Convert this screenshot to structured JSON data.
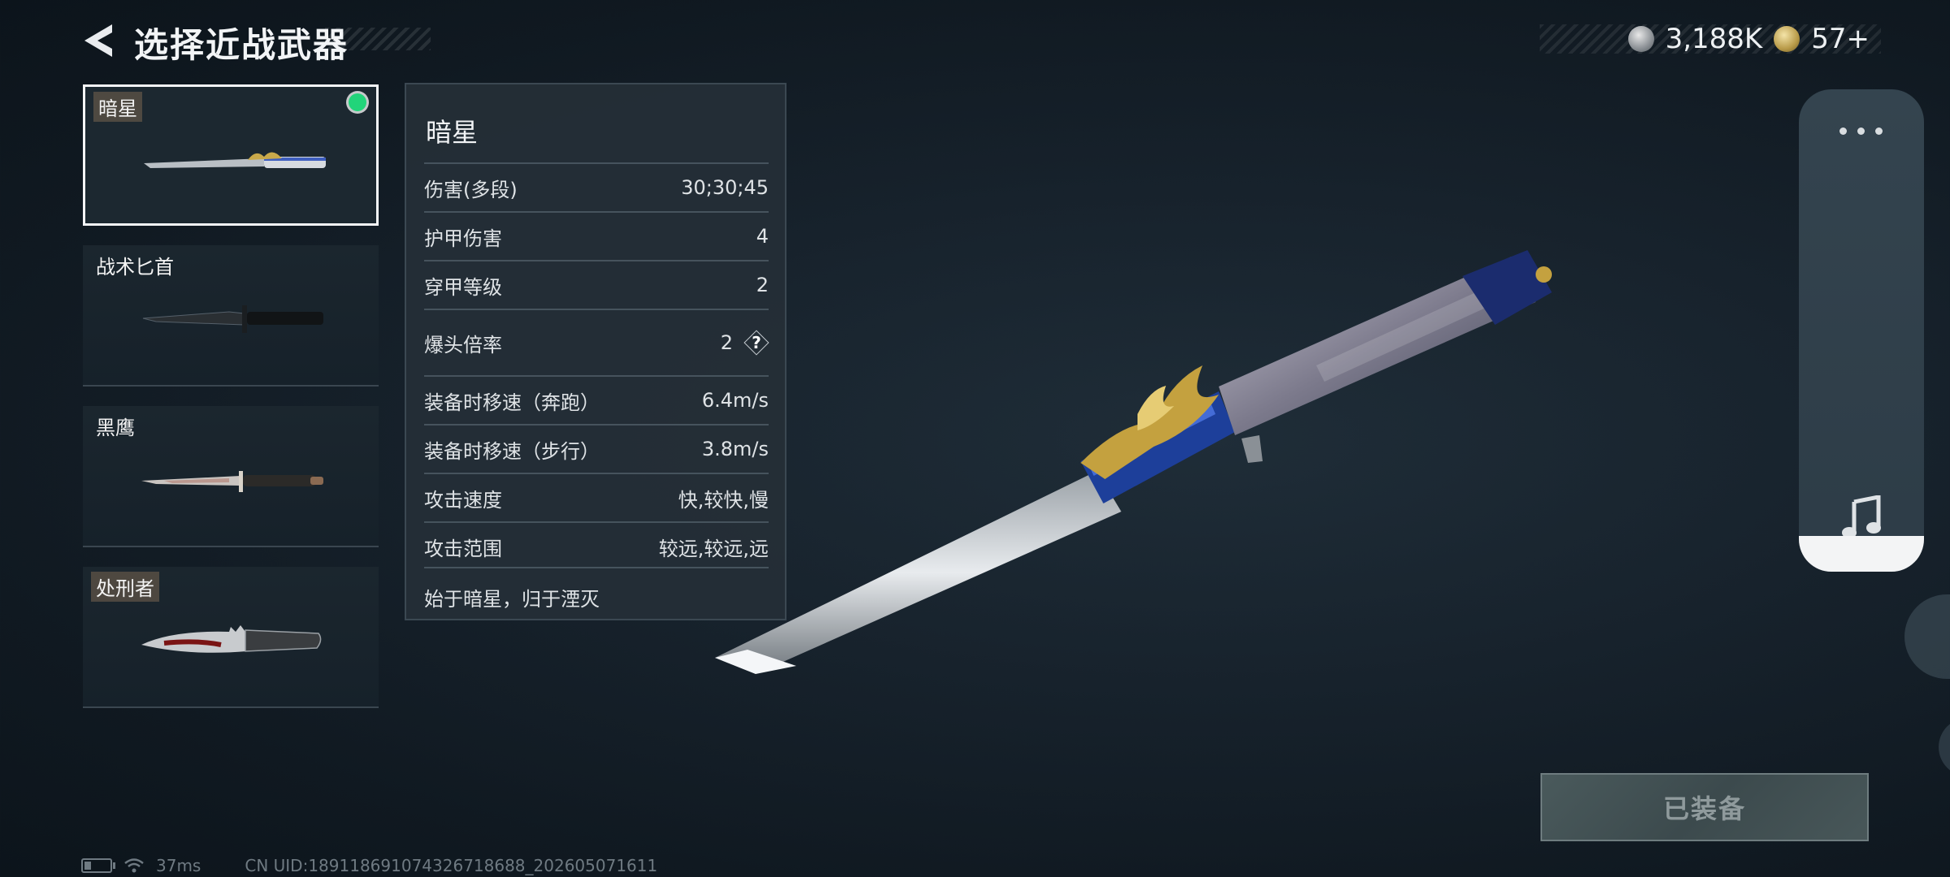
{
  "header": {
    "title": "选择近战武器",
    "currencies": [
      {
        "icon": "silver-coin-icon",
        "value": "3,188K"
      },
      {
        "icon": "gold-coin-icon",
        "value": "57+"
      }
    ]
  },
  "weapons": [
    {
      "name": "暗星",
      "selected": true,
      "equipped": true
    },
    {
      "name": "战术匕首",
      "selected": false,
      "equipped": false
    },
    {
      "name": "黑鹰",
      "selected": false,
      "equipped": false
    },
    {
      "name": "处刑者",
      "selected": false,
      "equipped": false
    }
  ],
  "stats_panel": {
    "weapon_name": "暗星",
    "rows": [
      {
        "label": "伤害(多段)",
        "value": "30;30;45"
      },
      {
        "label": "护甲伤害",
        "value": "4"
      },
      {
        "label": "穿甲等级",
        "value": "2"
      },
      {
        "label": "爆头倍率",
        "value": "2"
      },
      {
        "label": "装备时移速（奔跑）",
        "value": "6.4m/s"
      },
      {
        "label": "装备时移速（步行）",
        "value": "3.8m/s"
      },
      {
        "label": "攻击速度",
        "value": "快,较快,慢"
      },
      {
        "label": "攻击范围",
        "value": "较远,较远,远"
      }
    ],
    "description": "始于暗星，归于湮灭"
  },
  "side_panel": {
    "icons": [
      "more-icon",
      "music-icon"
    ]
  },
  "equip_button": {
    "label": "已装备"
  },
  "footer": {
    "ping": "37ms",
    "uid": "CN UID:189118691074326718688_202605071611"
  },
  "colors": {
    "equipped_dot": "#22d47a",
    "background": "#17222c",
    "panel": "#252f37"
  }
}
